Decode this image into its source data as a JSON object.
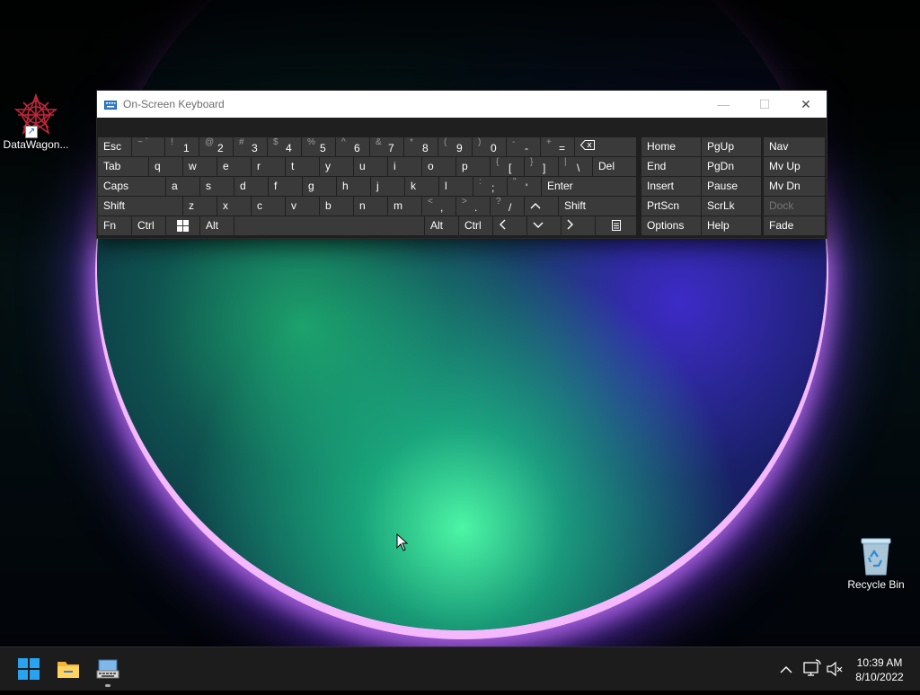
{
  "desktop": {
    "icons": [
      {
        "label": "DataWagon..."
      },
      {
        "label": "Recycle Bin"
      }
    ]
  },
  "osk": {
    "title": "On-Screen Keyboard",
    "rows": {
      "row1": {
        "esc": "Esc",
        "tilde": {
          "shift": "~ `",
          "primary": ""
        },
        "k1": {
          "shift": "!",
          "primary": "1"
        },
        "k2": {
          "shift": "@",
          "primary": "2"
        },
        "k3": {
          "shift": "#",
          "primary": "3"
        },
        "k4": {
          "shift": "$",
          "primary": "4"
        },
        "k5": {
          "shift": "%",
          "primary": "5"
        },
        "k6": {
          "shift": "^",
          "primary": "6"
        },
        "k7": {
          "shift": "&",
          "primary": "7"
        },
        "k8": {
          "shift": "*",
          "primary": "8"
        },
        "k9": {
          "shift": "(",
          "primary": "9"
        },
        "k0": {
          "shift": ")",
          "primary": "0"
        },
        "minus": {
          "shift": "-",
          "primary": "-"
        },
        "equals": {
          "shift": "+",
          "primary": "="
        }
      },
      "row2": {
        "tab": "Tab",
        "letters": [
          "q",
          "w",
          "e",
          "r",
          "t",
          "y",
          "u",
          "i",
          "o",
          "p"
        ],
        "lbracket": {
          "shift": "{",
          "primary": "["
        },
        "rbracket": {
          "shift": "}",
          "primary": "]"
        },
        "backslash": {
          "shift": "|",
          "primary": "\\"
        },
        "del": "Del"
      },
      "row3": {
        "caps": "Caps",
        "letters": [
          "a",
          "s",
          "d",
          "f",
          "g",
          "h",
          "j",
          "k",
          "l"
        ],
        "semicolon": {
          "shift": ":",
          "primary": ";"
        },
        "quote": {
          "shift": "\"",
          "primary": "'"
        },
        "enter": "Enter"
      },
      "row4": {
        "shift_left": "Shift",
        "letters": [
          "z",
          "x",
          "c",
          "v",
          "b",
          "n",
          "m"
        ],
        "comma": {
          "shift": "<",
          "primary": ","
        },
        "period": {
          "shift": ">",
          "primary": "."
        },
        "slash": {
          "shift": "?",
          "primary": "/"
        },
        "shift_right": "Shift"
      },
      "row5": {
        "fn": "Fn",
        "ctrl_left": "Ctrl",
        "alt_left": "Alt",
        "alt_right": "Alt",
        "ctrl_right": "Ctrl"
      }
    },
    "nav_keys": {
      "home": "Home",
      "pgup": "PgUp",
      "end": "End",
      "pgdn": "PgDn",
      "insert": "Insert",
      "pause": "Pause",
      "prtscn": "PrtScn",
      "scrlk": "ScrLk",
      "options": "Options",
      "help": "Help"
    },
    "side_keys": {
      "nav": "Nav",
      "mvup": "Mv Up",
      "mvdn": "Mv Dn",
      "dock": "Dock",
      "fade": "Fade"
    }
  },
  "taskbar": {
    "clock": {
      "time": "10:39 AM",
      "date": "8/10/2022"
    }
  },
  "colors": {
    "key_bg": "#3a3a3a",
    "keyboard_bg": "#1f1f1f",
    "taskbar_bg": "#1c1c1c",
    "accent_blue": "#29a3f0"
  }
}
